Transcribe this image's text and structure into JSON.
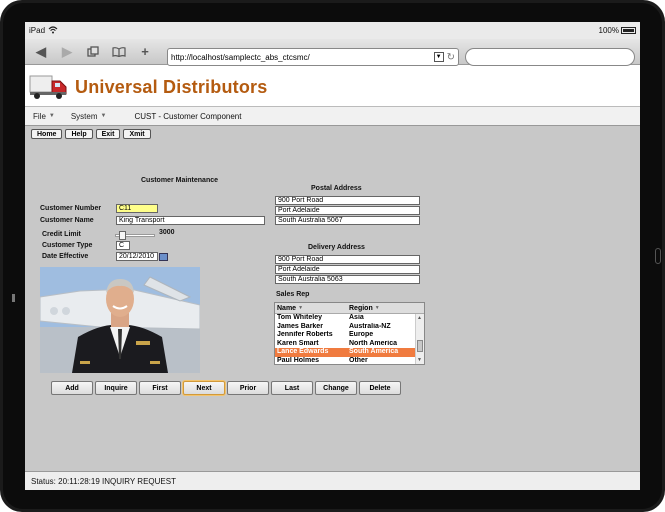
{
  "device": {
    "carrier": "iPad",
    "battery": "100%"
  },
  "browser": {
    "url": "http://localhost/samplectc_abs_ctcsmc/",
    "search_placeholder": ""
  },
  "app": {
    "title": "Universal Distributors",
    "menu": [
      {
        "label": "File"
      },
      {
        "label": "System"
      }
    ],
    "component_title": "CUST - Customer Component",
    "top_buttons": [
      "Home",
      "Help",
      "Exit",
      "Xmit"
    ]
  },
  "form": {
    "heading": "Customer Maintenance",
    "customer_number_label": "Customer Number",
    "customer_number": "C11",
    "customer_name_label": "Customer Name",
    "customer_name": "King Transport",
    "credit_limit_label": "Credit Limit",
    "credit_limit": "3000",
    "customer_type_label": "Customer Type",
    "customer_type": "C",
    "date_effective_label": "Date Effective",
    "date_effective": "20/12/2010"
  },
  "postal": {
    "heading": "Postal Address",
    "line1": "900 Port Road",
    "line2": "Port Adelaide",
    "line3": "South Australia 5067"
  },
  "delivery": {
    "heading": "Delivery Address",
    "line1": "900 Port Road",
    "line2": "Port Adelaide",
    "line3": "South Australia 5063"
  },
  "sales_rep": {
    "heading": "Sales Rep",
    "columns": [
      "Name",
      "Region"
    ],
    "rows": [
      {
        "name": "Tom Whiteley",
        "region": "Asia"
      },
      {
        "name": "James Barker",
        "region": "Australia-NZ"
      },
      {
        "name": "Jennifer Roberts",
        "region": "Europe"
      },
      {
        "name": "Karen Smart",
        "region": "North America"
      },
      {
        "name": "Lance Edwards",
        "region": "South America",
        "selected": true
      },
      {
        "name": "Paul Holmes",
        "region": "Other"
      }
    ]
  },
  "nav_buttons": [
    "Add",
    "Inquire",
    "First",
    "Next",
    "Prior",
    "Last",
    "Change",
    "Delete"
  ],
  "status": {
    "text": "Status: 20:11:28:19 INQUIRY REQUEST"
  },
  "colors": {
    "title": "#b45b10",
    "selected_row": "#f07b3f",
    "key_field": "#ffff8a"
  }
}
